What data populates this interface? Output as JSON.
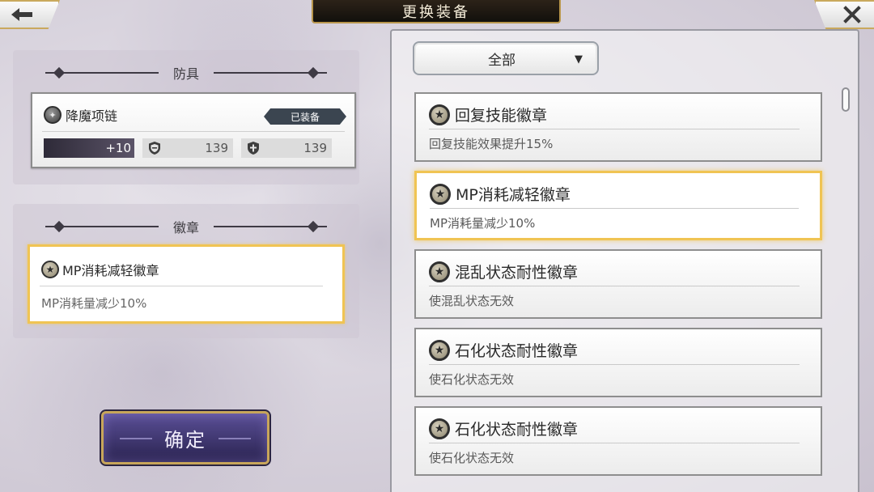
{
  "header": {
    "title": "更换装备",
    "back_icon": "arrow-left-icon",
    "close_icon": "close-x-icon"
  },
  "armor_section": {
    "label": "防具",
    "item": {
      "name": "降魔项链",
      "icon": "necklace-icon",
      "tag": "已装备",
      "level": "+10",
      "stats": [
        {
          "icon": "shield-icon",
          "value": "139"
        },
        {
          "icon": "cross-shield-icon",
          "value": "139"
        }
      ]
    }
  },
  "badge_section": {
    "label": "徽章",
    "item": {
      "name": "MP消耗减轻徽章",
      "icon": "star-badge-icon",
      "desc": "MP消耗量减少10%"
    }
  },
  "confirm_label": "确定",
  "filter": {
    "value": "全部",
    "icon": "dropdown-arrow-icon"
  },
  "badge_list": [
    {
      "name": "回复技能徽章",
      "desc": "回复技能效果提升15%",
      "selected": false
    },
    {
      "name": "MP消耗减轻徽章",
      "desc": "MP消耗量减少10%",
      "selected": true
    },
    {
      "name": "混乱状态耐性徽章",
      "desc": "使混乱状态无效",
      "selected": false
    },
    {
      "name": "石化状态耐性徽章",
      "desc": "使石化状态无效",
      "selected": false
    },
    {
      "name": "石化状态耐性徽章",
      "desc": "使石化状态无效",
      "selected": false
    }
  ],
  "colors": {
    "selected_border": "#f0c453",
    "title_bar": "#1c1812",
    "confirm_button": "#3d3572",
    "equipped_tag": "#3b4550"
  }
}
